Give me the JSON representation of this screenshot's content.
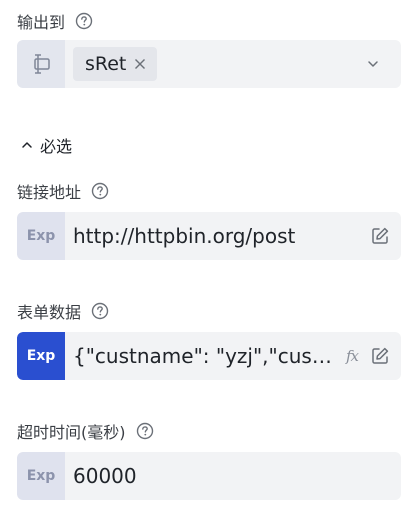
{
  "output": {
    "label": "输出到",
    "tag_value": "sRet"
  },
  "section": {
    "label": "必选"
  },
  "fields": {
    "url": {
      "label": "链接地址",
      "badge": "Exp",
      "value": "http://httpbin.org/post"
    },
    "form_data": {
      "label": "表单数据",
      "badge": "Exp",
      "value": "{\"custname\": \"yzj\",\"custtel\": \"\"}",
      "fx_label": "fx"
    },
    "timeout": {
      "label": "超时时间(毫秒)",
      "badge": "Exp",
      "value": "60000"
    }
  },
  "colors": {
    "accent": "#2a4fd0",
    "field_bg": "#f2f3f5",
    "badge_bg": "#dfe2ee",
    "badge_text": "#8c93ac",
    "icon_gray": "#8a8f99"
  },
  "icons": {
    "help": "question-circle-icon",
    "variable_type": "variable-type-icon",
    "tag_close": "close-icon",
    "dropdown": "chevron-down-icon",
    "section_toggle": "chevron-up-icon",
    "edit": "edit-icon",
    "function": "fx-icon"
  }
}
